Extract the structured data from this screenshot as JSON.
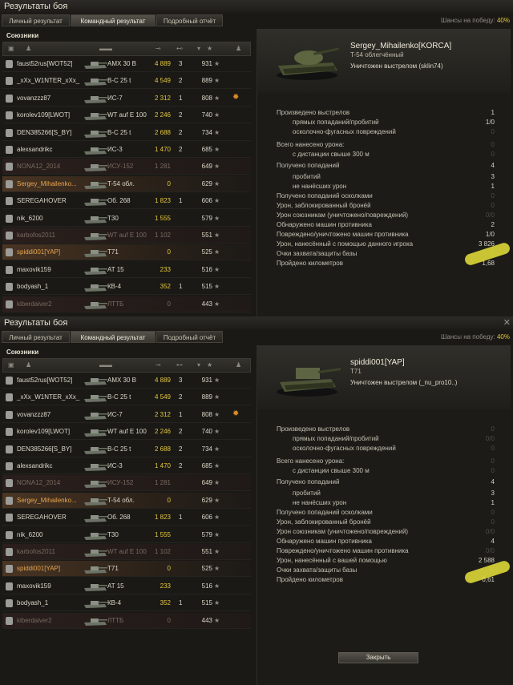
{
  "window": {
    "title": "Результаты боя",
    "close": "✕"
  },
  "tabs": [
    "Личный результат",
    "Командный результат",
    "Подробный отчёт"
  ],
  "odds": {
    "label": "Шансы на победу:",
    "value": "40%"
  },
  "team_label": "Союзники",
  "players": [
    {
      "name": "faust52rus[WOT52]",
      "vehicle": "AMX 30 B",
      "damage": "4 889",
      "kills": "3",
      "xp": "931",
      "state": "normal",
      "medal": ""
    },
    {
      "name": "_xXx_W1NTER_xXx_",
      "vehicle": "B-C 25 t",
      "damage": "4 549",
      "kills": "2",
      "xp": "889",
      "state": "normal",
      "medal": ""
    },
    {
      "name": "vovanzzz87",
      "vehicle": "ИС-7",
      "damage": "2 312",
      "kills": "1",
      "xp": "808",
      "state": "normal",
      "medal": "✹"
    },
    {
      "name": "korolev109[LWOT]",
      "vehicle": "WT auf E 100",
      "damage": "2 246",
      "kills": "2",
      "xp": "740",
      "state": "normal",
      "medal": ""
    },
    {
      "name": "DEN385266[S_BY]",
      "vehicle": "B-C 25 t",
      "damage": "2 688",
      "kills": "2",
      "xp": "734",
      "state": "normal",
      "medal": ""
    },
    {
      "name": "alexsandrikc",
      "vehicle": "ИС-3",
      "damage": "1 470",
      "kills": "2",
      "xp": "685",
      "state": "normal",
      "medal": ""
    },
    {
      "name": "NONA12_2014",
      "vehicle": "ИСУ-152",
      "damage": "1 281",
      "kills": "",
      "xp": "649",
      "state": "dead",
      "medal": ""
    },
    {
      "name": "Sergey_Mihailenko...",
      "vehicle": "T-54 обл.",
      "damage": "0",
      "kills": "",
      "xp": "629",
      "state": "self",
      "medal": ""
    },
    {
      "name": "SEREGAHOVER",
      "vehicle": "Об. 268",
      "damage": "1 823",
      "kills": "1",
      "xp": "606",
      "state": "normal",
      "medal": ""
    },
    {
      "name": "nik_6200",
      "vehicle": "T30",
      "damage": "1 555",
      "kills": "",
      "xp": "579",
      "state": "normal",
      "medal": ""
    },
    {
      "name": "karbofos2011",
      "vehicle": "WT auf E 100",
      "damage": "1 102",
      "kills": "",
      "xp": "551",
      "state": "dead",
      "medal": ""
    },
    {
      "name": "spiddi001[YAP]",
      "vehicle": "T71",
      "damage": "0",
      "kills": "",
      "xp": "525",
      "state": "self",
      "medal": ""
    },
    {
      "name": "maxovik159",
      "vehicle": "AT 15",
      "damage": "233",
      "kills": "",
      "xp": "516",
      "state": "normal",
      "medal": ""
    },
    {
      "name": "bodyash_1",
      "vehicle": "КВ-4",
      "damage": "352",
      "kills": "1",
      "xp": "515",
      "state": "normal",
      "medal": ""
    },
    {
      "name": "kiberdaiver2",
      "vehicle": "ЛТТБ",
      "damage": "0",
      "kills": "",
      "xp": "443",
      "state": "dead",
      "medal": ""
    }
  ],
  "stat_labels": [
    "Произведено выстрелов",
    "прямых попаданий/пробитий",
    "осколочно-фугасных повреждений",
    "Всего нанесено урона:",
    "с дистанции свыше 300 м",
    "Получено попаданий",
    "пробитий",
    "не нанёсших урон",
    "Получено попаданий осколками",
    "Урон, заблокированный бронёй",
    "Урон союзникам (уничтожено/повреждений)",
    "Обнаружено машин противника",
    "Повреждено/уничтожено машин противника",
    "Урон, нанесённый с помощью данного игрока",
    "Очки захвата/защиты базы",
    "Пройдено километров"
  ],
  "stat_labels_p2_assist": "Урон, нанесённый с вашей помощью",
  "detail1": {
    "player": "Sergey_Mihailenko[KORCA]",
    "vehicle": "T-54 облегчённый",
    "killed_by": "Уничтожен выстрелом (sklin74)",
    "values": [
      "1",
      "1/0",
      "0",
      "0",
      "0",
      "4",
      "3",
      "1",
      "0",
      "0",
      "0/0",
      "2",
      "1/0",
      "3 826",
      "0",
      "1,68"
    ]
  },
  "detail2": {
    "player": "spiddi001[YAP]",
    "vehicle": "T71",
    "killed_by": "Уничтожен выстрелом (_nu_pro10..)",
    "values": [
      "0",
      "0/0",
      "0",
      "0",
      "0",
      "4",
      "3",
      "1",
      "0",
      "0",
      "0/0",
      "4",
      "0/0",
      "2 588",
      "0",
      "0,61"
    ]
  },
  "close_button": "Закрыть",
  "colors": {
    "accent": "#e3c63d",
    "self_row": "#e8a650",
    "dead_row": "#7a6a60",
    "highlight": "#e7e23a"
  }
}
